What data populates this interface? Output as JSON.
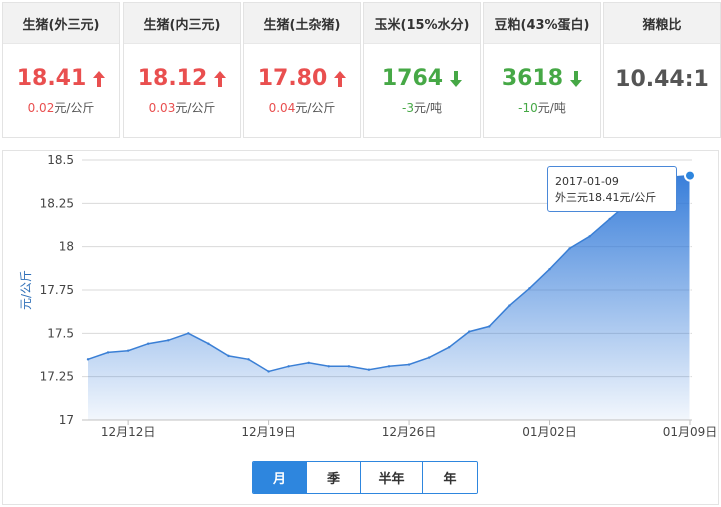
{
  "cards": [
    {
      "title": "生猪(外三元)",
      "value": "18.41",
      "change_num": "0.02",
      "change_unit": "元/公斤",
      "trend": "up"
    },
    {
      "title": "生猪(内三元)",
      "value": "18.12",
      "change_num": "0.03",
      "change_unit": "元/公斤",
      "trend": "up"
    },
    {
      "title": "生猪(土杂猪)",
      "value": "17.80",
      "change_num": "0.04",
      "change_unit": "元/公斤",
      "trend": "up"
    },
    {
      "title": "玉米(15%水分)",
      "value": "1764",
      "change_num": "-3",
      "change_unit": "元/吨",
      "trend": "down"
    },
    {
      "title": "豆粕(43%蛋白)",
      "value": "3618",
      "change_num": "-10",
      "change_unit": "元/吨",
      "trend": "down"
    },
    {
      "title": "猪粮比",
      "value": "10.44:1",
      "change_num": "",
      "change_unit": "",
      "trend": "neutral"
    }
  ],
  "colors": {
    "up": "#e94f4f",
    "down": "#46a846",
    "accent": "#2e86de",
    "line": "#3a7fd5"
  },
  "tooltip": {
    "date": "2017-01-09",
    "text": "外三元18.41元/公斤"
  },
  "period_buttons": [
    {
      "label": "月",
      "active": true
    },
    {
      "label": "季",
      "active": false
    },
    {
      "label": "半年",
      "active": false
    },
    {
      "label": "年",
      "active": false
    }
  ],
  "chart_data": {
    "type": "area",
    "ylabel": "元/公斤",
    "ylim": [
      17,
      18.5
    ],
    "yticks": [
      "17",
      "17.25",
      "17.5",
      "17.75",
      "18",
      "18.25",
      "18.5"
    ],
    "xticks": [
      "12月12日",
      "12月19日",
      "12月26日",
      "01月02日",
      "01月09日"
    ],
    "x": [
      "12-10",
      "12-11",
      "12-12",
      "12-13",
      "12-14",
      "12-15",
      "12-16",
      "12-17",
      "12-18",
      "12-19",
      "12-20",
      "12-21",
      "12-22",
      "12-23",
      "12-24",
      "12-25",
      "12-26",
      "12-27",
      "12-28",
      "12-29",
      "12-30",
      "12-31",
      "01-01",
      "01-02",
      "01-03",
      "01-04",
      "01-05",
      "01-06",
      "01-07",
      "01-08",
      "01-09"
    ],
    "series": [
      {
        "name": "外三元",
        "values": [
          17.35,
          17.39,
          17.4,
          17.44,
          17.46,
          17.5,
          17.44,
          17.37,
          17.35,
          17.28,
          17.31,
          17.33,
          17.31,
          17.31,
          17.29,
          17.31,
          17.32,
          17.36,
          17.42,
          17.51,
          17.54,
          17.66,
          17.76,
          17.87,
          17.99,
          18.06,
          18.16,
          18.26,
          18.38,
          18.4,
          18.41
        ]
      }
    ],
    "grid": true
  }
}
